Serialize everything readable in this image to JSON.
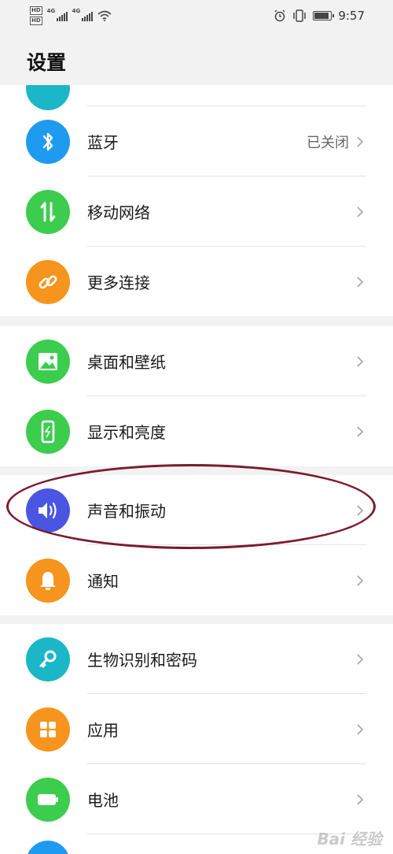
{
  "status": {
    "hd1": "HD",
    "hd2": "HD",
    "net1": "4G",
    "net2": "4G",
    "time": "9:57"
  },
  "header": {
    "title": "设置"
  },
  "groups": [
    {
      "items": [
        {
          "label": "蓝牙",
          "value": "已关闭",
          "icon": "bluetooth-icon",
          "color": "#1e9bf0"
        },
        {
          "label": "移动网络",
          "icon": "mobile-data-icon",
          "color": "#3ccc4e"
        },
        {
          "label": "更多连接",
          "icon": "link-icon",
          "color": "#f7941d"
        }
      ]
    },
    {
      "items": [
        {
          "label": "桌面和壁纸",
          "icon": "wallpaper-icon",
          "color": "#3ccc4e"
        },
        {
          "label": "显示和亮度",
          "icon": "display-icon",
          "color": "#3ccc4e"
        }
      ]
    },
    {
      "items": [
        {
          "label": "声音和振动",
          "icon": "sound-icon",
          "color": "#4a56e2"
        },
        {
          "label": "通知",
          "icon": "notification-bell-icon",
          "color": "#f7941d"
        }
      ]
    },
    {
      "items": [
        {
          "label": "生物识别和密码",
          "icon": "key-icon",
          "color": "#1bb7c9"
        },
        {
          "label": "应用",
          "icon": "apps-grid-icon",
          "color": "#f7941d"
        },
        {
          "label": "电池",
          "icon": "battery-icon",
          "color": "#3ccc4e"
        }
      ]
    }
  ],
  "watermark": "Bai 经验"
}
